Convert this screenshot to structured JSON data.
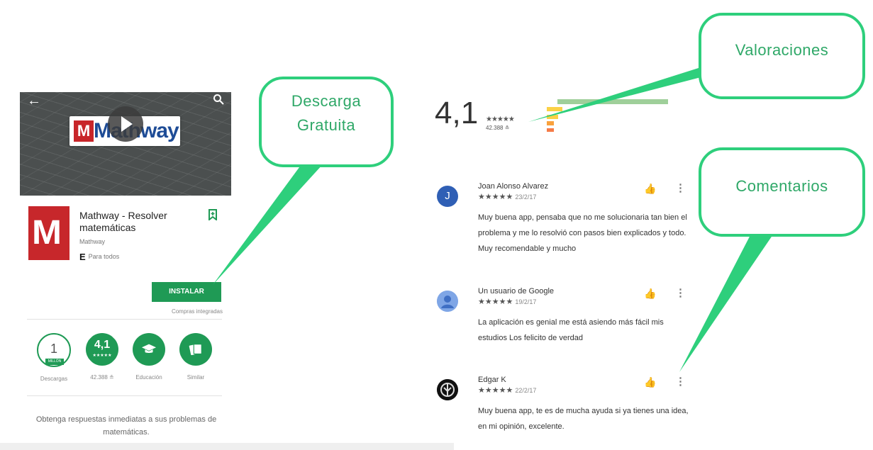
{
  "app": {
    "name": "Mathway - Resolver matemáticas",
    "hero_logo_text": "Mathway",
    "hero_logo_letter": "M",
    "icon_letter": "M",
    "developer": "Mathway",
    "content_rating_letter": "E",
    "content_rating": "Para todos",
    "install_label": "INSTALAR",
    "in_app_purchases": "Compras integradas",
    "description": "Obtenga respuestas inmediatas a sus problemas de matemáticas."
  },
  "stats": {
    "downloads_value": "1",
    "downloads_badge": "MILLÓN",
    "downloads_label": "Descargas",
    "rating_value": "4,1",
    "rating_stars": "★★★★★",
    "rating_label": "42.388 ≗",
    "category_label": "Educación",
    "similar_label": "Similar"
  },
  "rating_summary": {
    "score": "4,1",
    "stars": "★★★★★",
    "count": "42.388 ≗"
  },
  "reviews": [
    {
      "avatar_letter": "J",
      "author": "Joan Alonso Alvarez",
      "stars": "★★★★★",
      "date": "23/2/17",
      "text": "Muy buena app, pensaba que no me solucionaria tan bien el problema y me lo resolvió con pasos bien explicados y todo. Muy recomendable y mucho"
    },
    {
      "avatar_letter": "",
      "author": "Un usuario de Google",
      "stars": "★★★★★",
      "date": "19/2/17",
      "text": "La aplicación es genial me está asiendo más fácil mis estudios Los felicito de verdad"
    },
    {
      "avatar_letter": "",
      "author": "Edgar K",
      "stars": "★★★★★",
      "date": "22/2/17",
      "text": "Muy buena app, te es de mucha ayuda si ya tienes una idea, en mi opinión, excelente."
    }
  ],
  "callouts": {
    "download": "Descarga Gratuita",
    "ratings": "Valoraciones",
    "comments": "Comentarios"
  },
  "colors": {
    "accent_green": "#1f9a55",
    "callout_green": "#2ecf7c",
    "brand_red": "#c7272b",
    "brand_blue": "#1e4c96"
  },
  "icons": {
    "back": "arrow-back-icon",
    "search": "search-icon",
    "play": "play-icon",
    "wishlist": "bookmark-icon",
    "education": "graduation-cap-icon",
    "similar": "cards-icon",
    "thumb": "thumbs-up-icon",
    "more": "more-vert-icon"
  }
}
